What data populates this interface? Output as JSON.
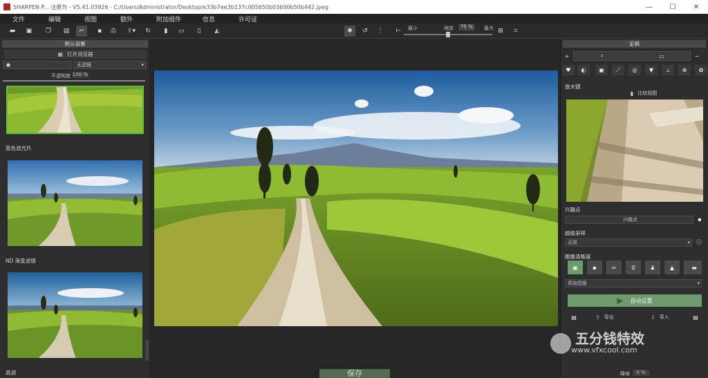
{
  "window": {
    "title": "SHARPEN P... 注册为 - V5.41.03926 - C:/Users/Administrator/Desktop/e33b7ee3b137c005650b03690b50b442.jpeg",
    "minimize": "—",
    "maximize": "☐",
    "close": "✕"
  },
  "menu": [
    "文件",
    "编辑",
    "视图",
    "额外",
    "附加组件",
    "信息",
    "许可证"
  ],
  "toolbar": {
    "zoom_min_label": "最小",
    "zoom_label": "缩放",
    "zoom_value": "75 %",
    "zoom_max_label": "最大",
    "zoom_slider_value": 0.5
  },
  "left_panel": {
    "header": "默认设置",
    "open_browser": "打开浏览器",
    "filter_value": "无滤镜",
    "opacity_label": "不透明度",
    "opacity_value": "100 %",
    "presets": [
      {
        "label": "蓝色滤光片"
      },
      {
        "label": "ND 渐变滤镜"
      },
      {
        "label": "高调"
      }
    ]
  },
  "center": {
    "save_label": "保存"
  },
  "right_panel": {
    "header": "定稿",
    "magnifier_title": "放大镜",
    "compare_view": "比较视图",
    "poi_section": "兴趣点",
    "poi_button": "兴趣点",
    "supersample_section": "超级采样",
    "supersample_value": "无效",
    "sharpness_section": "图像清晰度",
    "source_value": "原始图像",
    "auto_settings": "自动设置",
    "export": "导出",
    "import": "导入",
    "noise_label": "降噪",
    "noise_value": "0 %"
  },
  "watermark": {
    "text": "五分钱特效",
    "url": "www.vfxcool.com"
  }
}
